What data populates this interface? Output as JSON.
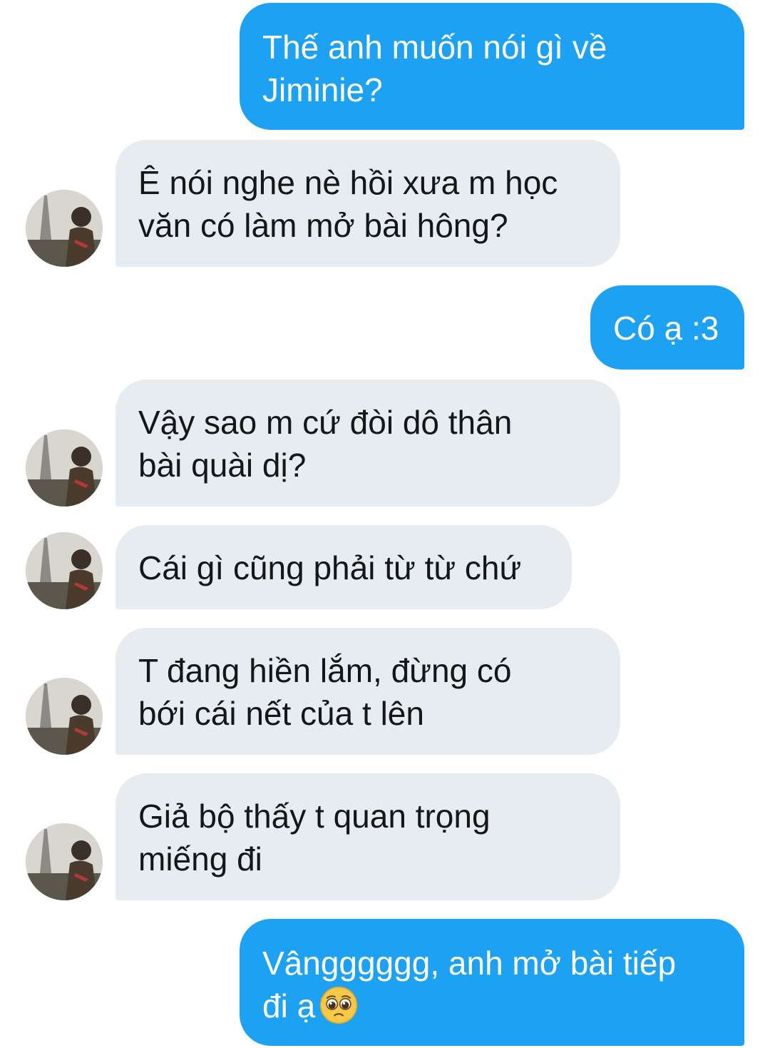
{
  "messages": [
    {
      "sender": "me",
      "lines": [
        "Thế anh muốn nói gì về",
        "Jiminie?"
      ]
    },
    {
      "sender": "them",
      "lines": [
        "Ê nói nghe nè hồi xưa m học",
        "văn có làm mở bài hông?"
      ]
    },
    {
      "sender": "me",
      "lines": [
        "Có ạ :3"
      ]
    },
    {
      "sender": "them",
      "lines": [
        "Vậy sao m cứ đòi dô thân",
        "bài quài dị?"
      ]
    },
    {
      "sender": "them",
      "lines": [
        "Cái gì cũng phải từ từ chứ"
      ]
    },
    {
      "sender": "them",
      "lines": [
        "T đang hiền lắm, đừng có",
        "bới cái nết của t lên"
      ]
    },
    {
      "sender": "them",
      "lines": [
        "Giả bộ thấy t quan trọng",
        "miếng đi"
      ]
    },
    {
      "sender": "me",
      "lines": [
        "Vângggggg, anh mở bài tiếp",
        "đi ạ"
      ],
      "emoji": "pleading-face-emoji"
    }
  ],
  "colors": {
    "sent_bubble": "#1da1f2",
    "received_bubble": "#e6ecf0",
    "sent_text": "#ffffff",
    "received_text": "#14171a"
  },
  "icons": {
    "avatar": "user-avatar-photo",
    "emoji": "pleading-face-emoji"
  }
}
